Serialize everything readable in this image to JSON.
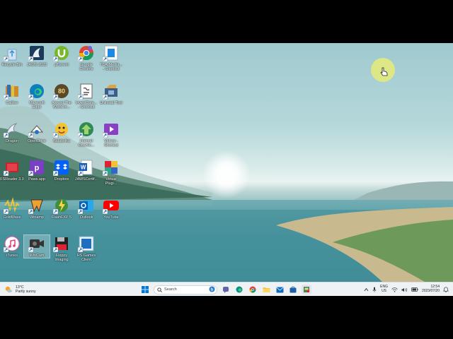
{
  "desktop": {
    "icons": [
      {
        "label": "Recycle Bin",
        "icon": "recycle-bin-icon"
      },
      {
        "label": "JAWS 2023",
        "icon": "jaws-icon"
      },
      {
        "label": "µTorrent",
        "icon": "utorrent-icon"
      },
      {
        "label": "Google\nChrome",
        "icon": "chrome-icon"
      },
      {
        "label": "TCA-Media...\n- Shortcut",
        "icon": "tca-media-icon"
      },
      {
        "label": "Calibre",
        "icon": "calibre-icon"
      },
      {
        "label": "Microsoft\nEdge",
        "icon": "edge-icon"
      },
      {
        "label": "Around The\nWorld In...",
        "icon": "around-world-icon"
      },
      {
        "label": "InventData...\n- Shortcut",
        "icon": "inventdata-icon"
      },
      {
        "label": "Uninstall Tool",
        "icon": "uninstall-tool-icon"
      },
      {
        "label": "Dragon",
        "icon": "dragon-icon"
      },
      {
        "label": "OpenDrive",
        "icon": "opendrive-icon"
      },
      {
        "label": "Balabolka",
        "icon": "balabolka-icon"
      },
      {
        "label": "Internet\nDownlo...",
        "icon": "idm-icon"
      },
      {
        "label": "Videos -\nShortcut",
        "icon": "videos-shortcut-icon"
      },
      {
        "label": "FSReader 3.0",
        "icon": "fsreader-icon"
      },
      {
        "label": "Paws.app",
        "icon": "paws-app-icon"
      },
      {
        "label": "Dropbox",
        "icon": "dropbox-icon"
      },
      {
        "label": "JAWSCertif...",
        "icon": "word-doc-icon"
      },
      {
        "label": "Virtual\nPlugi...",
        "icon": "virtual-plugin-icon"
      },
      {
        "label": "GoldWave",
        "icon": "goldwave-icon"
      },
      {
        "label": "Winamp",
        "icon": "winamp-icon"
      },
      {
        "label": "FlashFXP 5",
        "icon": "flashfxp-icon"
      },
      {
        "label": "Outlook",
        "icon": "outlook-icon"
      },
      {
        "label": "YouTube",
        "icon": "youtube-icon"
      },
      {
        "label": "iTunes",
        "icon": "itunes-icon"
      },
      {
        "label": "WinCam",
        "icon": "wincam-icon"
      },
      {
        "label": "Floppy\nImaging",
        "icon": "floppy-imaging-icon"
      },
      {
        "label": "RS Games\nClient",
        "icon": "rs-games-icon"
      }
    ]
  },
  "taskbar": {
    "weather": {
      "temp": "13°C",
      "condition": "Partly sunny",
      "icon": "partly-sunny-icon"
    },
    "start_icon": "windows-start-icon",
    "search_placeholder": "Search",
    "pinned": [
      "bing-icon",
      "teams-chat-icon",
      "edge-icon",
      "chrome-icon",
      "file-explorer-icon",
      "mail-icon",
      "store-icon",
      "app-icon"
    ],
    "tray": {
      "lang_top": "ENG",
      "lang_bottom": "US",
      "time": "12:54",
      "date": "2023/07/20"
    }
  },
  "colors": {
    "taskbar_bg": "#eef2f4",
    "cursor_halo": "#e6eb78",
    "accent": "#0067c0"
  }
}
